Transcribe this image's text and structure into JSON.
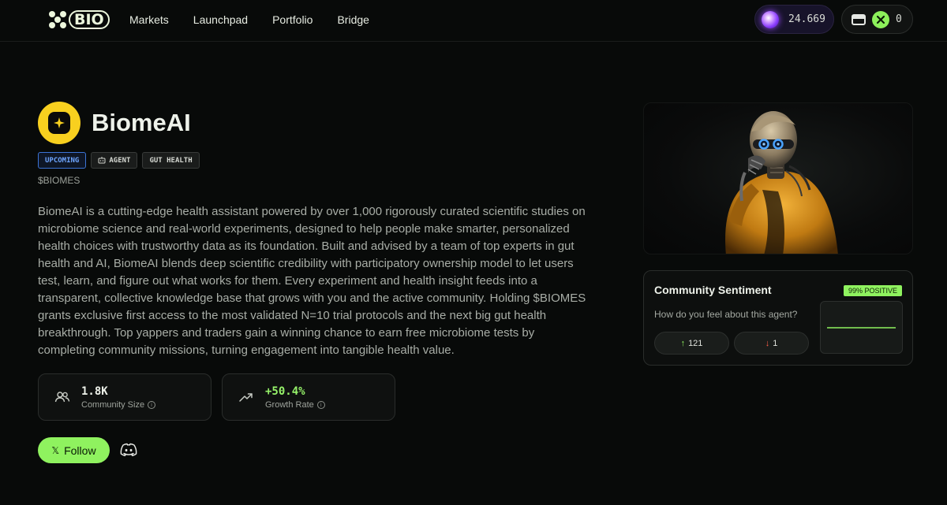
{
  "nav": {
    "logo": "BIO",
    "links": [
      "Markets",
      "Launchpad",
      "Portfolio",
      "Bridge"
    ],
    "balance": "24.669",
    "wallet_count": "0"
  },
  "project": {
    "name": "BiomeAI",
    "tags": [
      "UPCOMING",
      "AGENT",
      "GUT HEALTH"
    ],
    "ticker": "$BIOMES",
    "description": "BiomeAI is a cutting-edge health assistant powered by over 1,000 rigorously curated scientific studies on microbiome science and real-world experiments, designed to help people make smarter, personalized health choices with trustworthy data as its foundation. Built and advised by a team of top experts in gut health and AI, BiomeAI blends deep scientific credibility with participatory ownership model to let users test, learn, and figure out what works for them. Every experiment and health insight feeds into a transparent, collective knowledge base that grows with you and the active community. Holding $BIOMES grants exclusive first access to the most validated N=10 trial protocols and the next big gut health breakthrough. Top yappers and traders gain a winning chance to earn free microbiome tests by completing community missions, turning engagement into tangible health value."
  },
  "stats": [
    {
      "value": "1.8K",
      "label": "Community Size",
      "icon": "users-icon"
    },
    {
      "value": "+50.4%",
      "label": "Growth Rate",
      "icon": "trend-up-icon"
    }
  ],
  "actions": {
    "follow_label": "Follow",
    "follow_glyph": "𝕏"
  },
  "sentiment": {
    "title": "Community Sentiment",
    "badge": "99% POSITIVE",
    "question": "How do you feel about this agent?",
    "up_votes": "121",
    "down_votes": "1",
    "up_arrow": "↑",
    "down_arrow": "↓",
    "positive_fraction": 0.99
  },
  "colors": {
    "accent": "#8ff25f",
    "upcoming": "#6ea5ff",
    "avatar": "#f8d01f"
  }
}
